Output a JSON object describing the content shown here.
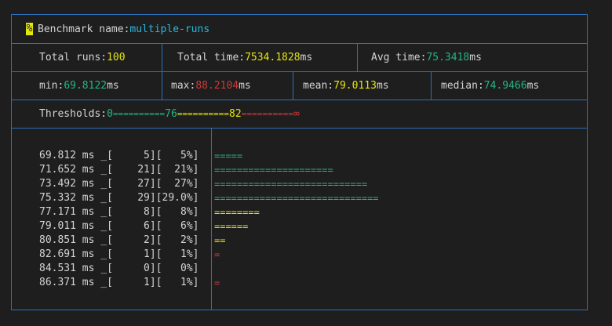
{
  "header": {
    "icon": "%",
    "label": "Benchmark name:",
    "name": "multiple-runs"
  },
  "summary": {
    "total_runs_label": "Total runs:",
    "total_runs": "100",
    "total_time_label": "Total time:",
    "total_time": "7534.1828",
    "total_time_unit": "ms",
    "avg_time_label": "Avg time:",
    "avg_time": "75.3418",
    "avg_time_unit": "ms"
  },
  "stats": {
    "min_label": "min:",
    "min": "69.8122",
    "min_unit": "ms",
    "max_label": "max:",
    "max": "88.2104",
    "max_unit": "ms",
    "mean_label": "mean:",
    "mean": "79.0113",
    "mean_unit": "ms",
    "median_label": "median:",
    "median": "74.9466",
    "median_unit": "ms"
  },
  "thresholds": {
    "label": "Thresholds:",
    "t0": "0",
    "bar1": "==========",
    "t1": "76",
    "bar2": "==========",
    "t2": "82",
    "bar3": "==========",
    "t3": "∞"
  },
  "histogram": {
    "rows": [
      {
        "text": "69.812 ms _[     5][   5%]",
        "bar": "=====",
        "color": "green"
      },
      {
        "text": "71.652 ms _[    21][  21%]",
        "bar": "=====================",
        "color": "green"
      },
      {
        "text": "73.492 ms _[    27][  27%]",
        "bar": "===========================",
        "color": "green"
      },
      {
        "text": "75.332 ms _[    29][29.0%]",
        "bar": "=============================",
        "color": "green"
      },
      {
        "text": "77.171 ms _[     8][   8%]",
        "bar": "========",
        "color": "yellow"
      },
      {
        "text": "79.011 ms _[     6][   6%]",
        "bar": "======",
        "color": "yellow"
      },
      {
        "text": "80.851 ms _[     2][   2%]",
        "bar": "==",
        "color": "yellow"
      },
      {
        "text": "82.691 ms _[     1][   1%]",
        "bar": "=",
        "color": "red"
      },
      {
        "text": "84.531 ms _[     0][   0%]",
        "bar": "",
        "color": "red"
      },
      {
        "text": "86.371 ms _[     1][   1%]",
        "bar": "=",
        "color": "red"
      }
    ]
  }
}
